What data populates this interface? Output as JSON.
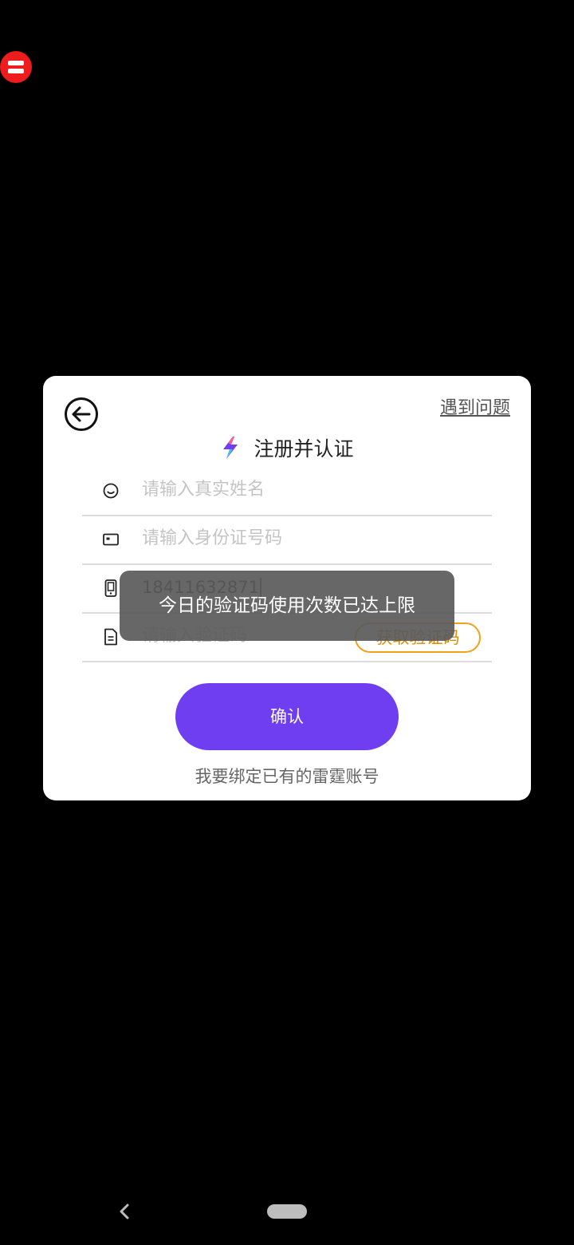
{
  "dialog": {
    "help_label": "遇到问题",
    "title": "注册并认证",
    "fields": {
      "name_placeholder": "请输入真实姓名",
      "id_placeholder": "请输入身份证号码",
      "phone_value": "18411632871",
      "code_placeholder": "请输入验证码"
    },
    "get_code_label": "获取验证码",
    "confirm_label": "确认",
    "bind_link": "我要绑定已有的雷霆账号"
  },
  "toast": {
    "message": "今日的验证码使用次数已达上限"
  },
  "colors": {
    "accent": "#6f3ef0",
    "code_button": "#f0a21a",
    "float_ball": "#ee1c1c"
  },
  "icons": {
    "back": "arrow-left-circle-icon",
    "logo": "lightning-logo-icon",
    "name": "smiley-icon",
    "id": "id-card-icon",
    "phone": "phone-icon",
    "code": "document-icon",
    "float": "menu-ball-icon"
  }
}
